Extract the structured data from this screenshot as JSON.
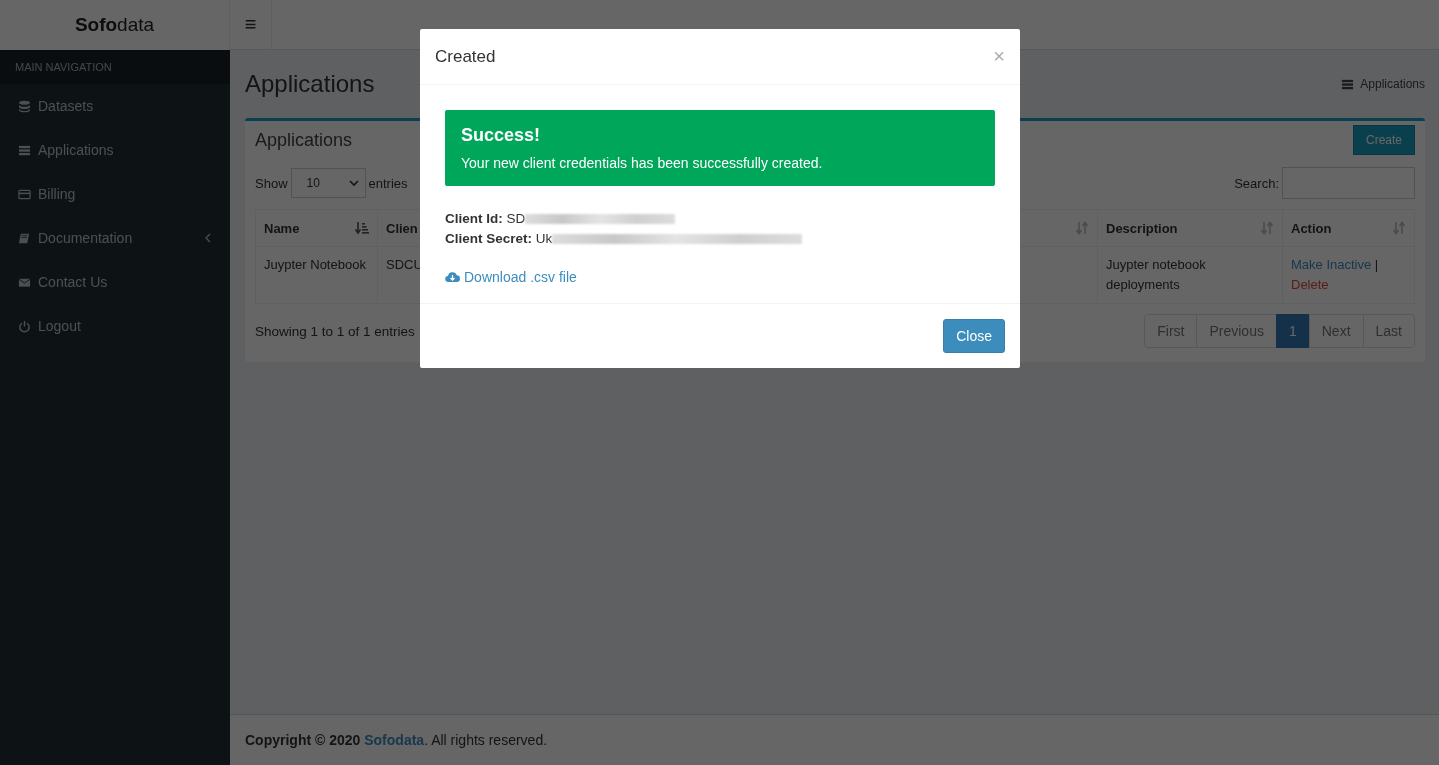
{
  "header": {
    "logo": "**Sofo**data",
    "menu_toggle": "≡"
  },
  "sidebar": {
    "heading": "MAIN NAVIGATION",
    "items": [
      {
        "label": "Datasets",
        "kind": "link"
      },
      {
        "label": "Applications",
        "kind": "link"
      },
      {
        "label": "Billing",
        "kind": "link"
      },
      {
        "label": "Documentation",
        "kind": "tree"
      },
      {
        "label": "Contact Us",
        "kind": "link"
      },
      {
        "label": "Logout",
        "kind": "link"
      }
    ]
  },
  "page": {
    "title": "Applications",
    "breadcrumb": "Applications"
  },
  "box": {
    "title": "Applications",
    "create_button": "Create",
    "show_label": "Show",
    "page_size": "10",
    "entries_label": "entries",
    "search_label": "Search:",
    "table": {
      "columns": [
        {
          "label": "Name",
          "kind": "sorted"
        },
        {
          "label": "Clien",
          "kind": "plain"
        },
        {
          "kind": "sortable"
        },
        {
          "label": "Description",
          "kind": "sortable"
        },
        {
          "label": "Action",
          "kind": "sortable"
        }
      ],
      "rows": [
        {
          "name": "Juypter Notebook",
          "client": "SDCU",
          "description": "Juypter notebook deployments",
          "actions": [
            {
              "label": "Make Inactive",
              "kind": "link"
            },
            {
              "label": "|",
              "kind": "separator"
            },
            {
              "label": "Delete",
              "kind": "danger"
            }
          ]
        }
      ]
    },
    "info": "Showing 1 to 1 of 1 entries",
    "pagination": [
      {
        "label": "First",
        "selected": false
      },
      {
        "label": "Previous",
        "selected": false
      },
      {
        "label": "1",
        "selected": true
      },
      {
        "label": "Next",
        "selected": false
      },
      {
        "label": "Last",
        "selected": false
      }
    ]
  },
  "footer": {
    "text": "**Copyright © 2020** ",
    "link": "Sofodata",
    "rest": ". All rights reserved."
  },
  "modal": {
    "title": "Created",
    "close_icon": "×",
    "alert": {
      "title": "Success!",
      "message": "Your new client credentials has been successfully created."
    },
    "credentials": [
      {
        "label": "Client Id:",
        "value": "SD"
      },
      {
        "label": "Client Secret:",
        "value": "Uk"
      }
    ],
    "download": "Download .csv file",
    "close_button": "Close"
  }
}
